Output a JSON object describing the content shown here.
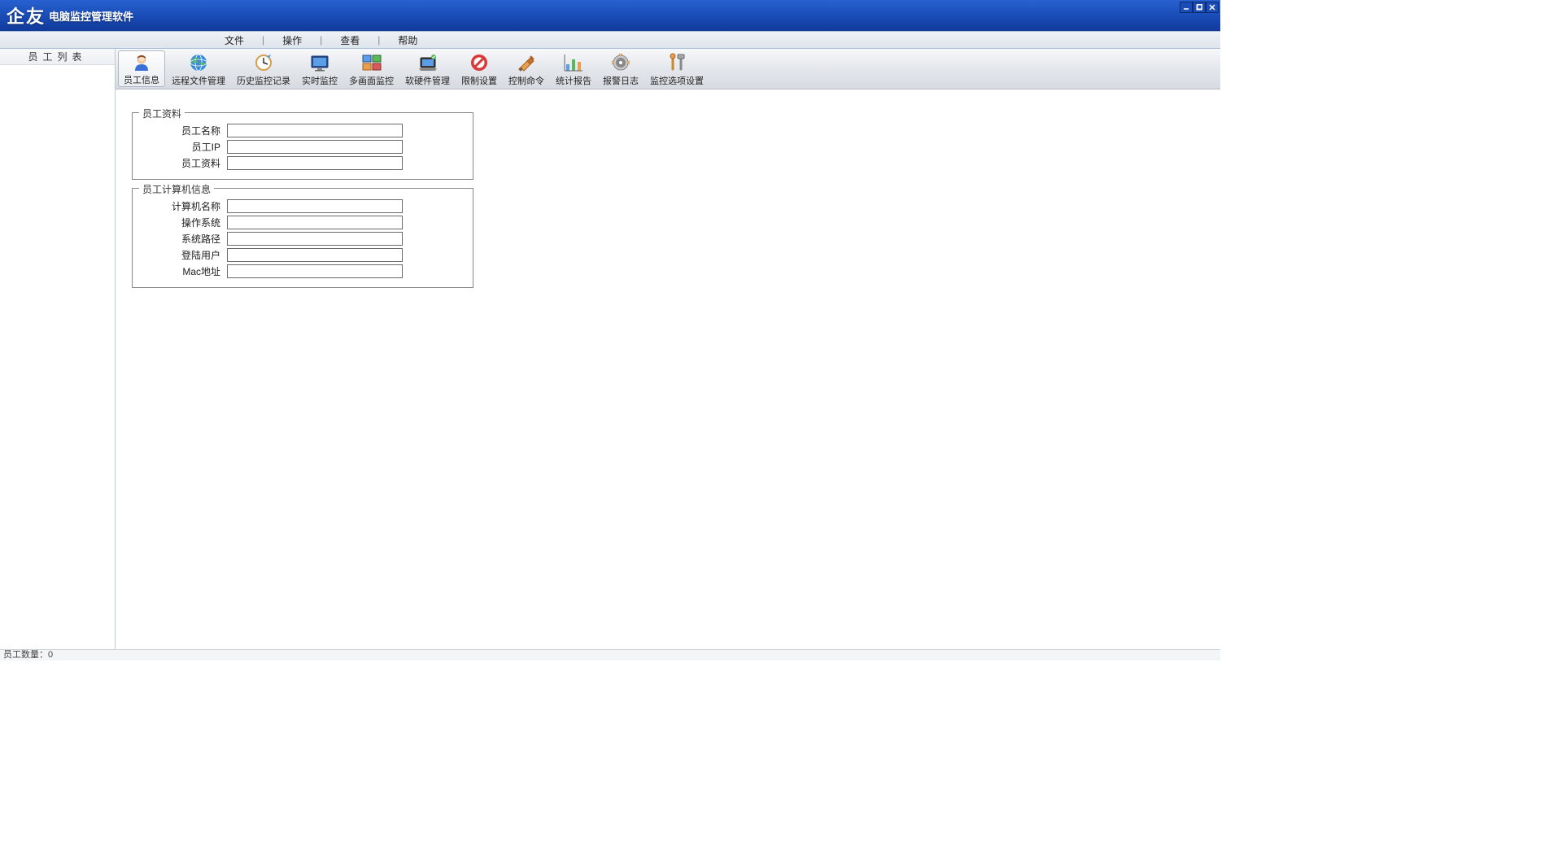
{
  "title": {
    "logo": "企友",
    "sub": "电脑监控管理软件"
  },
  "menu": {
    "file": "文件",
    "operate": "操作",
    "view": "查看",
    "help": "帮助"
  },
  "sidebar": {
    "header": "员工列表"
  },
  "toolbar": [
    {
      "id": "employee-info",
      "label": "员工信息",
      "active": true
    },
    {
      "id": "remote-file",
      "label": "远程文件管理",
      "active": false
    },
    {
      "id": "history",
      "label": "历史监控记录",
      "active": false
    },
    {
      "id": "realtime",
      "label": "实时监控",
      "active": false
    },
    {
      "id": "multiscreen",
      "label": "多画面监控",
      "active": false
    },
    {
      "id": "hw-sw",
      "label": "软硬件管理",
      "active": false
    },
    {
      "id": "restrict",
      "label": "限制设置",
      "active": false
    },
    {
      "id": "control",
      "label": "控制命令",
      "active": false
    },
    {
      "id": "stats",
      "label": "统计报告",
      "active": false
    },
    {
      "id": "alarm",
      "label": "报警日志",
      "active": false
    },
    {
      "id": "options",
      "label": "监控选项设置",
      "active": false
    }
  ],
  "form": {
    "group1": {
      "legend": "员工资料",
      "rows": [
        {
          "label": "员工名称",
          "value": ""
        },
        {
          "label": "员工IP",
          "value": ""
        },
        {
          "label": "员工资料",
          "value": ""
        }
      ]
    },
    "group2": {
      "legend": "员工计算机信息",
      "rows": [
        {
          "label": "计算机名称",
          "value": ""
        },
        {
          "label": "操作系统",
          "value": ""
        },
        {
          "label": "系统路径",
          "value": ""
        },
        {
          "label": "登陆用户",
          "value": ""
        },
        {
          "label": "Mac地址",
          "value": ""
        }
      ]
    }
  },
  "status": "员工数量：0"
}
